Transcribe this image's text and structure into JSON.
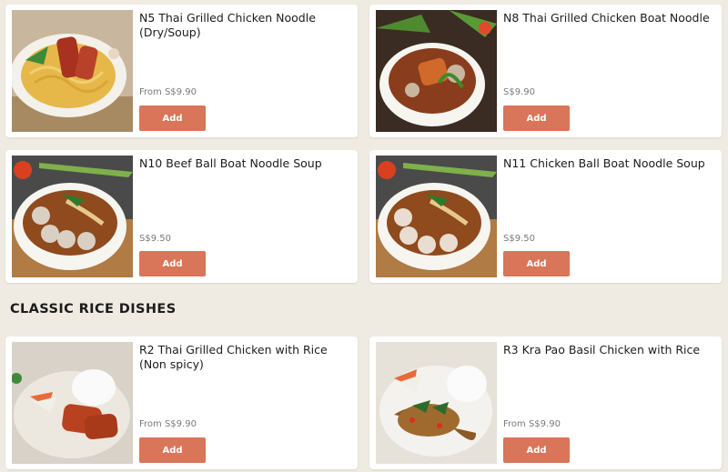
{
  "section": {
    "heading": "CLASSIC RICE DISHES"
  },
  "items": [
    {
      "title": "N5    Thai Grilled Chicken Noodle (Dry/Soup)",
      "price": "From S$9.90",
      "button": "Add"
    },
    {
      "title": "N8 Thai Grilled Chicken Boat Noodle",
      "price": "S$9.90",
      "button": "Add"
    },
    {
      "title": "N10  Beef Ball Boat Noodle Soup",
      "price": "S$9.50",
      "button": "Add"
    },
    {
      "title": "N11   Chicken Ball Boat Noodle Soup",
      "price": "S$9.50",
      "button": "Add"
    },
    {
      "title": "R2 Thai Grilled Chicken with Rice (Non spicy)",
      "price": "From S$9.90",
      "button": "Add"
    },
    {
      "title": "R3 Kra Pao Basil Chicken with Rice",
      "price": "From S$9.90",
      "button": "Add"
    }
  ],
  "colors": {
    "background": "#efebe2",
    "card": "#ffffff",
    "accent": "#d97558"
  }
}
